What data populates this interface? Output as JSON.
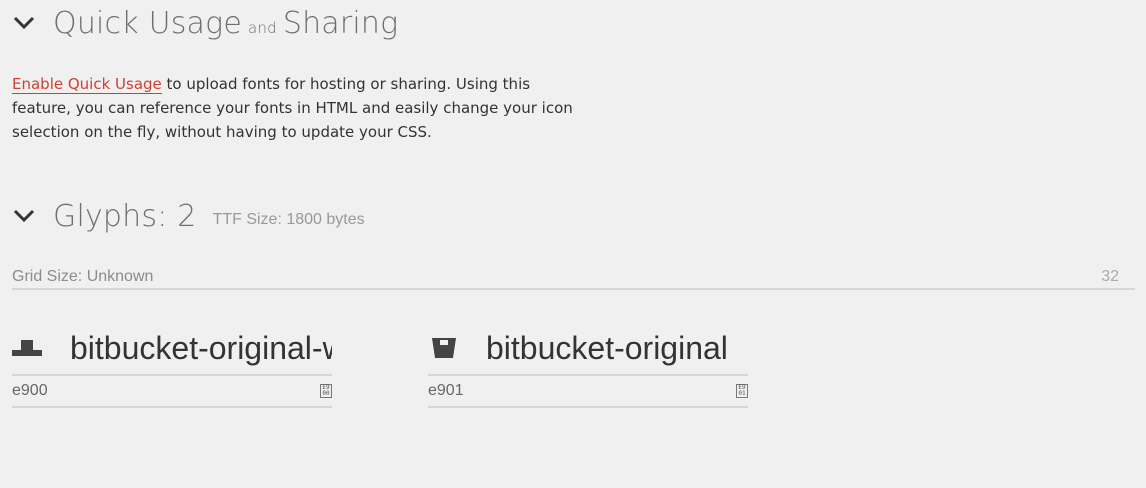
{
  "quick_usage": {
    "title_main": "Quick Usage",
    "title_and": "and",
    "title_end": "Sharing",
    "link_text": "Enable Quick Usage",
    "paragraph_rest": " to upload fonts for hosting or sharing. Using this feature, you can reference your fonts in HTML and easily change your icon selection on the fly, without having to update your CSS."
  },
  "glyphs": {
    "title": "Glyphs: 2",
    "ttf_size": "TTF Size: 1800 bytes",
    "grid_label": "Grid Size: Unknown",
    "grid_value": "32",
    "items": [
      {
        "name": "bitbucket-original-wordmark",
        "code": "e900",
        "icon": "bitbucket-wordmark-icon"
      },
      {
        "name": "bitbucket-original",
        "code": "e901",
        "icon": "bitbucket-icon"
      }
    ]
  }
}
